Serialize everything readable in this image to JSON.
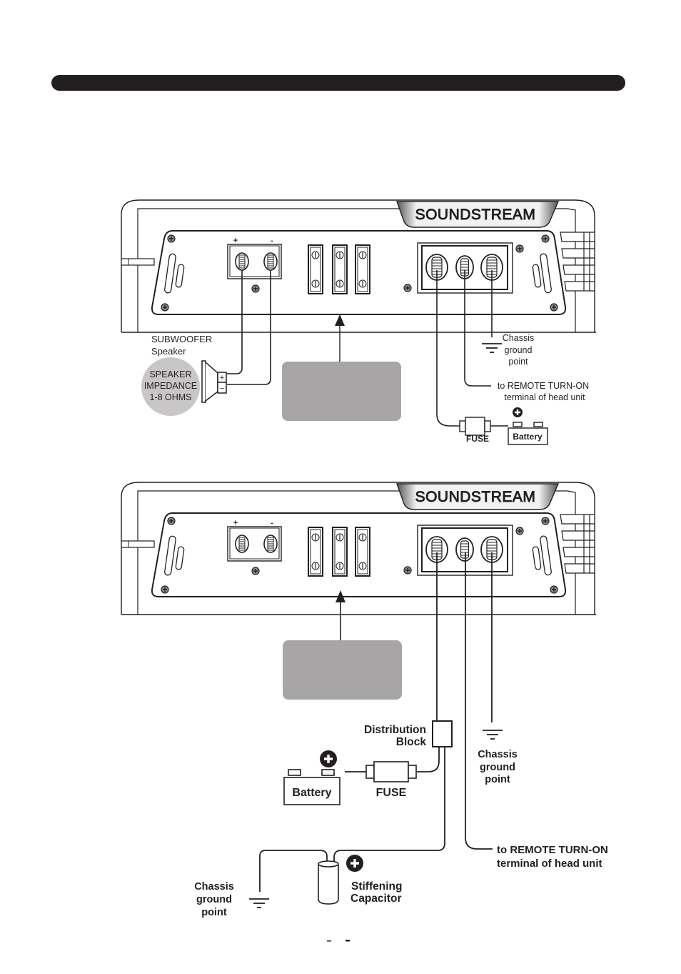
{
  "header": {
    "title": ""
  },
  "colors": {
    "ink": "#231f20",
    "grey_box": "#a7a5a6",
    "impedance_circle": "#c8c6c7"
  },
  "amp_top": {
    "brand": "SOUNDSTREAM",
    "speaker_terminal_plus": "+",
    "speaker_terminal_minus": "-",
    "subwoofer_label_line1": "SUBWOOFER",
    "subwoofer_label_line2": "Speaker",
    "impedance_line1": "SPEAKER",
    "impedance_line2": "IMPEDANCE",
    "impedance_line3": "1-8 OHMS",
    "speaker_plus": "+",
    "speaker_minus": "−",
    "chassis_line1": "Chassis",
    "chassis_line2": "ground",
    "chassis_line3": "point",
    "remote_line1": "to REMOTE TURN-ON",
    "remote_line2": "terminal of head unit",
    "fuse_label": "FUSE",
    "battery_label": "Battery",
    "callout_box_text": ""
  },
  "amp_bottom": {
    "brand": "SOUNDSTREAM",
    "speaker_terminal_plus": "+",
    "speaker_terminal_minus": "-",
    "distribution_line1": "Distribution",
    "distribution_line2": "Block",
    "battery_label": "Battery",
    "fuse_label": "FUSE",
    "chassis_line1": "Chassis",
    "chassis_line2": "ground",
    "chassis_line3": "point",
    "remote_line1": "to REMOTE TURN-ON",
    "remote_line2": "terminal of head unit",
    "cap_chassis_line1": "Chassis",
    "cap_chassis_line2": "ground",
    "cap_chassis_line3": "point",
    "capacitor_line1": "Stiffening",
    "capacitor_line2": "Capacitor",
    "callout_box_text": ""
  },
  "footer": {
    "page_number": ""
  }
}
